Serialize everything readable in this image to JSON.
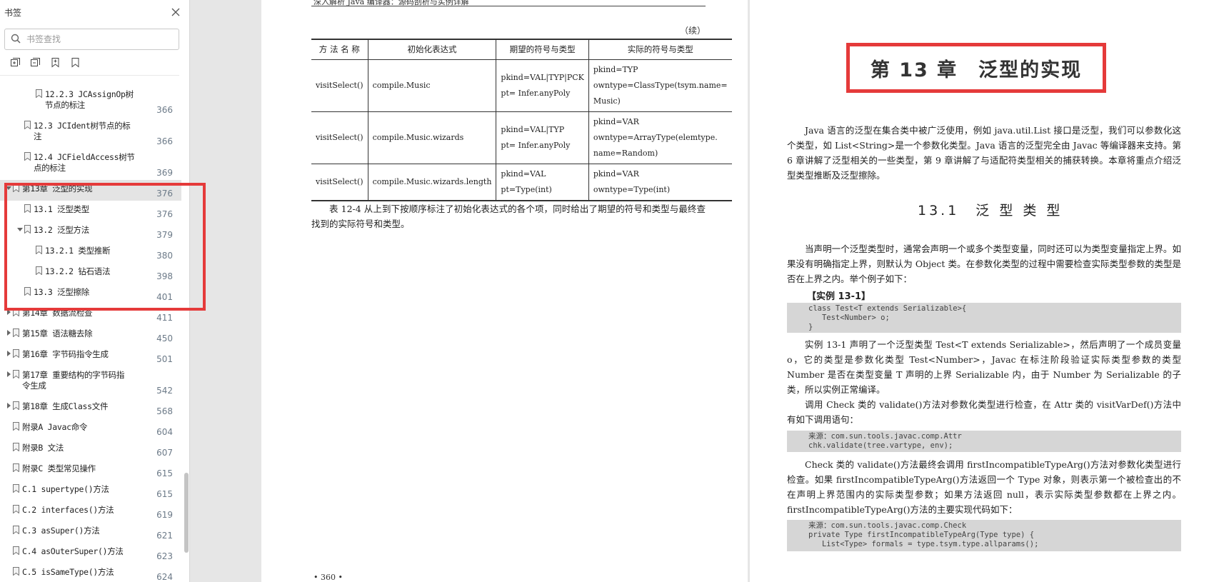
{
  "sidebar": {
    "title": "书签",
    "search_placeholder": "书签查找",
    "tools": [
      "expand-all-icon",
      "collapse-all-icon",
      "add-bookmark-icon",
      "bookmark-icon"
    ],
    "items": [
      {
        "label": "12.2.3 JCAssignOp树",
        "label2": "节点的标注",
        "page": "366",
        "level": 3,
        "arrow": ""
      },
      {
        "label": "12.3 JCIdent树节点的标",
        "label2": "注",
        "page": "366",
        "level": 2,
        "arrow": ""
      },
      {
        "label": "12.4 JCFieldAccess树节",
        "label2": "点的标注",
        "page": "369",
        "level": 2,
        "arrow": ""
      },
      {
        "label": "第13章 泛型的实现",
        "label2": "",
        "page": "376",
        "level": 1,
        "arrow": "down",
        "selected": true
      },
      {
        "label": "13.1 泛型类型",
        "label2": "",
        "page": "376",
        "level": 2,
        "arrow": ""
      },
      {
        "label": "13.2 泛型方法",
        "label2": "",
        "page": "379",
        "level": 2,
        "arrow": "down"
      },
      {
        "label": "13.2.1 类型推断",
        "label2": "",
        "page": "380",
        "level": 3,
        "arrow": ""
      },
      {
        "label": "13.2.2 钻石语法",
        "label2": "",
        "page": "398",
        "level": 3,
        "arrow": ""
      },
      {
        "label": "13.3 泛型擦除",
        "label2": "",
        "page": "401",
        "level": 2,
        "arrow": ""
      },
      {
        "label": "第14章 数据流检查",
        "label2": "",
        "page": "411",
        "level": 1,
        "arrow": "right"
      },
      {
        "label": "第15章 语法糖去除",
        "label2": "",
        "page": "450",
        "level": 1,
        "arrow": "right"
      },
      {
        "label": "第16章 字节码指令生成",
        "label2": "",
        "page": "501",
        "level": 1,
        "arrow": "right"
      },
      {
        "label": "第17章 重要结构的字节码指",
        "label2": "令生成",
        "page": "542",
        "level": 1,
        "arrow": "right"
      },
      {
        "label": "第18章 生成Class文件",
        "label2": "",
        "page": "568",
        "level": 1,
        "arrow": "right"
      },
      {
        "label": "附录A Javac命令",
        "label2": "",
        "page": "604",
        "level": 1,
        "arrow": ""
      },
      {
        "label": "附录B 文法",
        "label2": "",
        "page": "607",
        "level": 1,
        "arrow": ""
      },
      {
        "label": "附录C 类型常见操作",
        "label2": "",
        "page": "615",
        "level": 1,
        "arrow": ""
      },
      {
        "label": "C.1 supertype()方法",
        "label2": "",
        "page": "615",
        "level": 1,
        "arrow": ""
      },
      {
        "label": "C.2 interfaces()方法",
        "label2": "",
        "page": "619",
        "level": 1,
        "arrow": ""
      },
      {
        "label": "C.3 asSuper()方法",
        "label2": "",
        "page": "621",
        "level": 1,
        "arrow": ""
      },
      {
        "label": "C.4 asOuterSuper()方法",
        "label2": "",
        "page": "623",
        "level": 1,
        "arrow": ""
      },
      {
        "label": "C.5 isSameType()方法",
        "label2": "",
        "page": "624",
        "level": 1,
        "arrow": ""
      }
    ]
  },
  "left_page": {
    "running_head": "深入解析 Java 编译器：源码剖析与实例详解",
    "continued": "（续）",
    "table": {
      "headers": [
        "方 法 名 称",
        "初始化表达式",
        "期望的符号与类型",
        "实际的符号与类型"
      ],
      "rows": [
        {
          "method": "visitSelect()",
          "expr": "compile.Music",
          "expected": [
            "pkind=VAL|TYP|PCK",
            "pt= Infer.anyPoly"
          ],
          "actual": [
            "pkind=TYP",
            "owntype=ClassType(tsym.name=",
            "Music)"
          ]
        },
        {
          "method": "visitSelect()",
          "expr": "compile.Music.wizards",
          "expected": [
            "pkind=VAL|TYP",
            "pt= Infer.anyPoly"
          ],
          "actual": [
            "pkind=VAR",
            "owntype=ArrayType(elemtype.",
            "name=Random)"
          ]
        },
        {
          "method": "visitSelect()",
          "expr": "compile.Music.wizards.length",
          "expected": [
            "pkind=VAL",
            "pt=Type(int)"
          ],
          "actual": [
            "pkind=VAR",
            "owntype=Type(int)"
          ]
        }
      ]
    },
    "paragraph": "表 12-4 从上到下按顺序标注了初始化表达式的各个项，同时给出了期望的符号和类型与最终查找到的实际符号和类型。",
    "page_number": "• 360 •"
  },
  "right_page": {
    "chapter_title": "第 13 章　泛型的实现",
    "intro": "Java 语言的泛型在集合类中被广泛使用，例如 java.util.List 接口是泛型，我们可以参数化这个类型，如 List<String>是一个参数化类型。Java 语言的泛型完全由 Javac 等编译器来支持。第 6 章讲解了泛型相关的一些类型，第 9 章讲解了与适配符类型相关的捕获转换。本章将重点介绍泛型类型推断及泛型擦除。",
    "section_title": "13.1　泛 型 类 型",
    "para1": "当声明一个泛型类型时，通常会声明一个或多个类型变量，同时还可以为类型变量指定上界。如果没有明确指定上界，则默认为 Object 类。在参数化类型的过程中需要检查实际类型参数的类型是否在上界之内。举个例子如下：",
    "example_label": "【实例 13-1】",
    "code1": "class Test<T extends Serializable>{\n   Test<Number> o;\n}",
    "para2": "实例 13-1 声明了一个泛型类型 Test<T extends Serializable>，然后声明了一个成员变量 o，它的类型是参数化类型 Test<Number>，Javac 在标注阶段验证实际类型参数的类型 Number 是否在类型变量 T 声明的上界 Serializable 内，由于 Number 为 Serializable 的子类，所以实例正常编译。",
    "para3": "调用 Check 类的 validate()方法对参数化类型进行检查，在 Attr 类的 visitVarDef()方法中有如下调用语句：",
    "code2": "来源：com.sun.tools.javac.comp.Attr\nchk.validate(tree.vartype, env);",
    "para4": "Check 类的 validate()方法最终会调用 firstIncompatibleTypeArg()方法对参数化类型进行检查。如果 firstIncompatibleTypeArg()方法返回一个 Type 对象，则表示第一个被检查出的不在声明上界范围内的实际类型参数；如果方法返回 null，表示实际类型参数都在上界之内。firstIncompatibleTypeArg()方法的主要实现代码如下：",
    "code3": "来源：com.sun.tools.javac.comp.Check\nprivate Type firstIncompatibleTypeArg(Type type) {\n   List<Type> formals = type.tsym.type.allparams();"
  },
  "colors": {
    "highlight": "#e53a3a",
    "selected_row": "#e4e4e4",
    "page_number_text": "#6c7a88"
  }
}
